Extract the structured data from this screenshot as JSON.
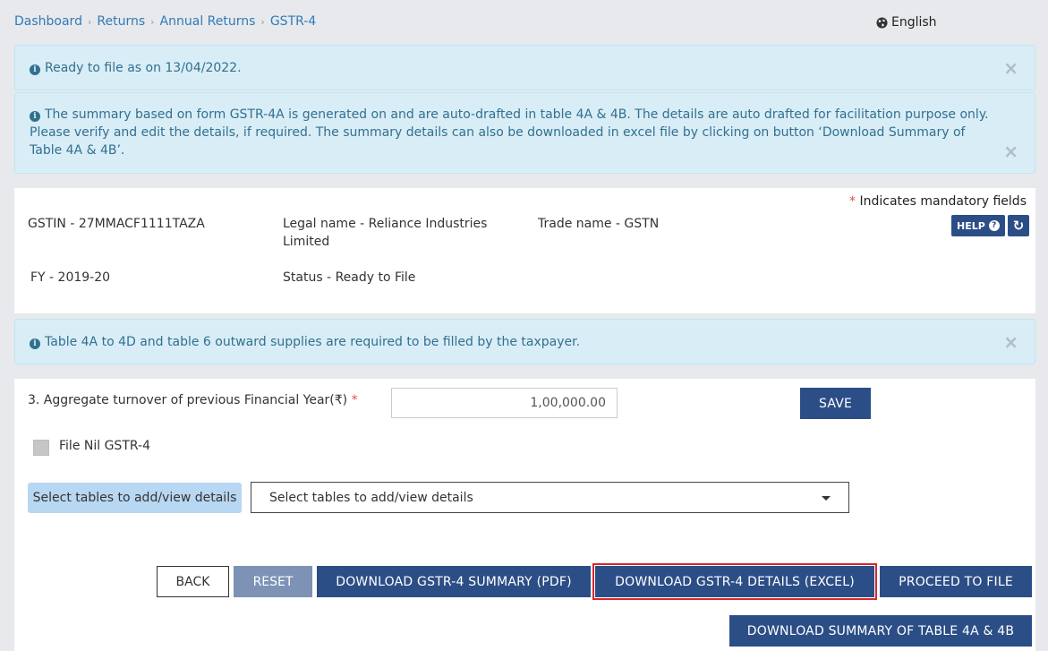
{
  "breadcrumb": [
    "Dashboard",
    "Returns",
    "Annual Returns",
    "GSTR-4"
  ],
  "language": {
    "label": "English",
    "icon": "globe-icon"
  },
  "alerts": {
    "ready": "Ready to file as on 13/04/2022.",
    "summary_line1": "The summary based on form GSTR-4A is generated on and are auto-drafted in table 4A & 4B. The details are auto drafted for facilitation purpose only.",
    "summary_line2": "Please verify and edit the details, if required. The summary details can also be downloaded in excel file by clicking on button ‘Download Summary of",
    "summary_line3": "Table 4A & 4B’.",
    "tables_required": "Table 4A to 4D and table 6 outward supplies are required to be filled by the taxpayer.",
    "close_symbol": "×"
  },
  "details": {
    "mandatory_star": "*",
    "mandatory_text": "Indicates mandatory fields",
    "gstin": "GSTIN - 27MMACF1111TAZA",
    "legal_name_line1": "Legal name - Reliance Industries",
    "legal_name_line2": "Limited",
    "trade_name": "Trade name - GSTN",
    "fy": "FY - 2019-20",
    "status": "Status - Ready to File",
    "help_label": "HELP",
    "help_icon": "?",
    "refresh_icon": "↻"
  },
  "form": {
    "turnover_label": "3. Aggregate turnover of previous Financial Year(₹)",
    "turnover_star": "*",
    "turnover_value": "1,00,000.00",
    "save_label": "SAVE",
    "nil_label": "File Nil GSTR-4",
    "select_label": "Select tables to add/view details",
    "select_value": "Select tables to add/view details"
  },
  "actions": {
    "back": "BACK",
    "reset": "RESET",
    "download_pdf": "DOWNLOAD GSTR-4 SUMMARY (PDF)",
    "download_excel": "DOWNLOAD GSTR-4 DETAILS (EXCEL)",
    "proceed": "PROCEED TO FILE",
    "download_summary": "DOWNLOAD SUMMARY OF TABLE 4A & 4B"
  }
}
